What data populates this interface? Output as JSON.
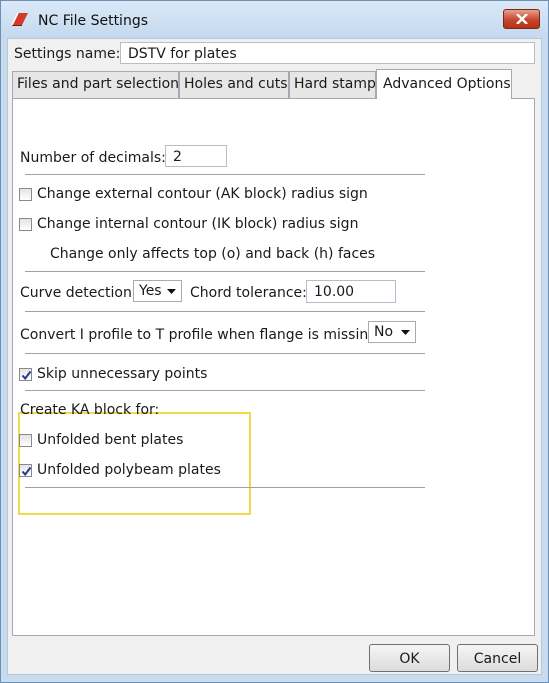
{
  "window": {
    "title": "NC File Settings"
  },
  "settings": {
    "name_label": "Settings name:",
    "name_value": "DSTV for plates"
  },
  "tabs": [
    {
      "label": "Files and part selection"
    },
    {
      "label": "Holes and cuts"
    },
    {
      "label": "Hard stamp"
    },
    {
      "label": "Advanced Options"
    }
  ],
  "advanced": {
    "decimals_label": "Number of decimals:",
    "decimals_value": "2",
    "ak_label": "Change external contour (AK block) radius sign",
    "ak_checked": false,
    "ik_label": "Change internal contour (IK block) radius sign",
    "ik_checked": false,
    "affect_note": "Change only affects top (o) and back (h) faces",
    "curve_label": "Curve detection:",
    "curve_value": "Yes",
    "chord_label": "Chord tolerance:",
    "chord_value": "10.00",
    "convert_label": "Convert I profile to T profile when flange is missing:",
    "convert_value": "No",
    "skip_label": "Skip unnecessary points",
    "skip_checked": true,
    "ka_heading": "Create KA block for:",
    "bent_label": "Unfolded bent plates",
    "bent_checked": false,
    "poly_label": "Unfolded polybeam plates",
    "poly_checked": true
  },
  "buttons": {
    "ok": "OK",
    "cancel": "Cancel"
  },
  "colors": {
    "highlight": "#f2d94b",
    "close": "#c6452d"
  }
}
